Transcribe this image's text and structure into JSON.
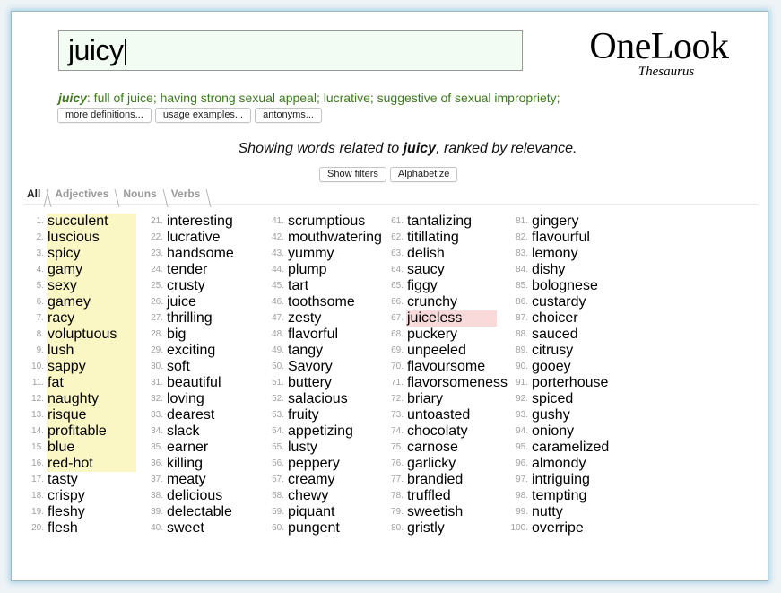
{
  "search": {
    "value": "juicy"
  },
  "logo": {
    "main": "OneLook",
    "sub": "Thesaurus"
  },
  "definition": {
    "headword": "juicy",
    "text": ": full of juice; having strong sexual appeal; lucrative; suggestive of sexual impropriety;"
  },
  "definition_buttons": [
    "more definitions...",
    "usage examples...",
    "antonyms..."
  ],
  "showing": {
    "prefix": "Showing words related to ",
    "word": "juicy",
    "suffix": ", ranked by relevance."
  },
  "filter_buttons": [
    "Show filters",
    "Alphabetize"
  ],
  "tabs": [
    {
      "label": "All",
      "active": true
    },
    {
      "label": "Adjectives",
      "active": false
    },
    {
      "label": "Nouns",
      "active": false
    },
    {
      "label": "Verbs",
      "active": false
    }
  ],
  "colors": {
    "definition": "#3d7a1e",
    "highlight_yellow": "#fbf7c5",
    "highlight_pink": "#f9d9da",
    "search_bg": "#f3fcf3"
  },
  "results": [
    {
      "n": "1.",
      "w": "succulent",
      "hl": "yellow"
    },
    {
      "n": "2.",
      "w": "luscious",
      "hl": "yellow"
    },
    {
      "n": "3.",
      "w": "spicy",
      "hl": "yellow"
    },
    {
      "n": "4.",
      "w": "gamy",
      "hl": "yellow"
    },
    {
      "n": "5.",
      "w": "sexy",
      "hl": "yellow"
    },
    {
      "n": "6.",
      "w": "gamey",
      "hl": "yellow"
    },
    {
      "n": "7.",
      "w": "racy",
      "hl": "yellow"
    },
    {
      "n": "8.",
      "w": "voluptuous",
      "hl": "yellow"
    },
    {
      "n": "9.",
      "w": "lush",
      "hl": "yellow"
    },
    {
      "n": "10.",
      "w": "sappy",
      "hl": "yellow"
    },
    {
      "n": "11.",
      "w": "fat",
      "hl": "yellow"
    },
    {
      "n": "12.",
      "w": "naughty",
      "hl": "yellow"
    },
    {
      "n": "13.",
      "w": "risque",
      "hl": "yellow"
    },
    {
      "n": "14.",
      "w": "profitable",
      "hl": "yellow"
    },
    {
      "n": "15.",
      "w": "blue",
      "hl": "yellow"
    },
    {
      "n": "16.",
      "w": "red-hot",
      "hl": "yellow"
    },
    {
      "n": "17.",
      "w": "tasty",
      "hl": ""
    },
    {
      "n": "18.",
      "w": "crispy",
      "hl": ""
    },
    {
      "n": "19.",
      "w": "fleshy",
      "hl": ""
    },
    {
      "n": "20.",
      "w": "flesh",
      "hl": ""
    },
    {
      "n": "21.",
      "w": "interesting",
      "hl": ""
    },
    {
      "n": "22.",
      "w": "lucrative",
      "hl": ""
    },
    {
      "n": "23.",
      "w": "handsome",
      "hl": ""
    },
    {
      "n": "24.",
      "w": "tender",
      "hl": ""
    },
    {
      "n": "25.",
      "w": "crusty",
      "hl": ""
    },
    {
      "n": "26.",
      "w": "juice",
      "hl": ""
    },
    {
      "n": "27.",
      "w": "thrilling",
      "hl": ""
    },
    {
      "n": "28.",
      "w": "big",
      "hl": ""
    },
    {
      "n": "29.",
      "w": "exciting",
      "hl": ""
    },
    {
      "n": "30.",
      "w": "soft",
      "hl": ""
    },
    {
      "n": "31.",
      "w": "beautiful",
      "hl": ""
    },
    {
      "n": "32.",
      "w": "loving",
      "hl": ""
    },
    {
      "n": "33.",
      "w": "dearest",
      "hl": ""
    },
    {
      "n": "34.",
      "w": "slack",
      "hl": ""
    },
    {
      "n": "35.",
      "w": "earner",
      "hl": ""
    },
    {
      "n": "36.",
      "w": "killing",
      "hl": ""
    },
    {
      "n": "37.",
      "w": "meaty",
      "hl": ""
    },
    {
      "n": "38.",
      "w": "delicious",
      "hl": ""
    },
    {
      "n": "39.",
      "w": "delectable",
      "hl": ""
    },
    {
      "n": "40.",
      "w": "sweet",
      "hl": ""
    },
    {
      "n": "41.",
      "w": "scrumptious",
      "hl": ""
    },
    {
      "n": "42.",
      "w": "mouthwatering",
      "hl": ""
    },
    {
      "n": "43.",
      "w": "yummy",
      "hl": ""
    },
    {
      "n": "44.",
      "w": "plump",
      "hl": ""
    },
    {
      "n": "45.",
      "w": "tart",
      "hl": ""
    },
    {
      "n": "46.",
      "w": "toothsome",
      "hl": ""
    },
    {
      "n": "47.",
      "w": "zesty",
      "hl": ""
    },
    {
      "n": "48.",
      "w": "flavorful",
      "hl": ""
    },
    {
      "n": "49.",
      "w": "tangy",
      "hl": ""
    },
    {
      "n": "50.",
      "w": "Savory",
      "hl": ""
    },
    {
      "n": "51.",
      "w": "buttery",
      "hl": ""
    },
    {
      "n": "52.",
      "w": "salacious",
      "hl": ""
    },
    {
      "n": "53.",
      "w": "fruity",
      "hl": ""
    },
    {
      "n": "54.",
      "w": "appetizing",
      "hl": ""
    },
    {
      "n": "55.",
      "w": "lusty",
      "hl": ""
    },
    {
      "n": "56.",
      "w": "peppery",
      "hl": ""
    },
    {
      "n": "57.",
      "w": "creamy",
      "hl": ""
    },
    {
      "n": "58.",
      "w": "chewy",
      "hl": ""
    },
    {
      "n": "59.",
      "w": "piquant",
      "hl": ""
    },
    {
      "n": "60.",
      "w": "pungent",
      "hl": ""
    },
    {
      "n": "61.",
      "w": "tantalizing",
      "hl": ""
    },
    {
      "n": "62.",
      "w": "titillating",
      "hl": ""
    },
    {
      "n": "63.",
      "w": "delish",
      "hl": ""
    },
    {
      "n": "64.",
      "w": "saucy",
      "hl": ""
    },
    {
      "n": "65.",
      "w": "figgy",
      "hl": ""
    },
    {
      "n": "66.",
      "w": "crunchy",
      "hl": ""
    },
    {
      "n": "67.",
      "w": "juiceless",
      "hl": "pink"
    },
    {
      "n": "68.",
      "w": "puckery",
      "hl": ""
    },
    {
      "n": "69.",
      "w": "unpeeled",
      "hl": ""
    },
    {
      "n": "70.",
      "w": "flavoursome",
      "hl": ""
    },
    {
      "n": "71.",
      "w": "flavorsomeness",
      "hl": ""
    },
    {
      "n": "72.",
      "w": "briary",
      "hl": ""
    },
    {
      "n": "73.",
      "w": "untoasted",
      "hl": ""
    },
    {
      "n": "74.",
      "w": "chocolaty",
      "hl": ""
    },
    {
      "n": "75.",
      "w": "carnose",
      "hl": ""
    },
    {
      "n": "76.",
      "w": "garlicky",
      "hl": ""
    },
    {
      "n": "77.",
      "w": "brandied",
      "hl": ""
    },
    {
      "n": "78.",
      "w": "truffled",
      "hl": ""
    },
    {
      "n": "79.",
      "w": "sweetish",
      "hl": ""
    },
    {
      "n": "80.",
      "w": "gristly",
      "hl": ""
    },
    {
      "n": "81.",
      "w": "gingery",
      "hl": ""
    },
    {
      "n": "82.",
      "w": "flavourful",
      "hl": ""
    },
    {
      "n": "83.",
      "w": "lemony",
      "hl": ""
    },
    {
      "n": "84.",
      "w": "dishy",
      "hl": ""
    },
    {
      "n": "85.",
      "w": "bolognese",
      "hl": ""
    },
    {
      "n": "86.",
      "w": "custardy",
      "hl": ""
    },
    {
      "n": "87.",
      "w": "choicer",
      "hl": ""
    },
    {
      "n": "88.",
      "w": "sauced",
      "hl": ""
    },
    {
      "n": "89.",
      "w": "citrusy",
      "hl": ""
    },
    {
      "n": "90.",
      "w": "gooey",
      "hl": ""
    },
    {
      "n": "91.",
      "w": "porterhouse",
      "hl": ""
    },
    {
      "n": "92.",
      "w": "spiced",
      "hl": ""
    },
    {
      "n": "93.",
      "w": "gushy",
      "hl": ""
    },
    {
      "n": "94.",
      "w": "oniony",
      "hl": ""
    },
    {
      "n": "95.",
      "w": "caramelized",
      "hl": ""
    },
    {
      "n": "96.",
      "w": "almondy",
      "hl": ""
    },
    {
      "n": "97.",
      "w": "intriguing",
      "hl": ""
    },
    {
      "n": "98.",
      "w": "tempting",
      "hl": ""
    },
    {
      "n": "99.",
      "w": "nutty",
      "hl": ""
    },
    {
      "n": "100.",
      "w": "overripe",
      "hl": ""
    }
  ]
}
